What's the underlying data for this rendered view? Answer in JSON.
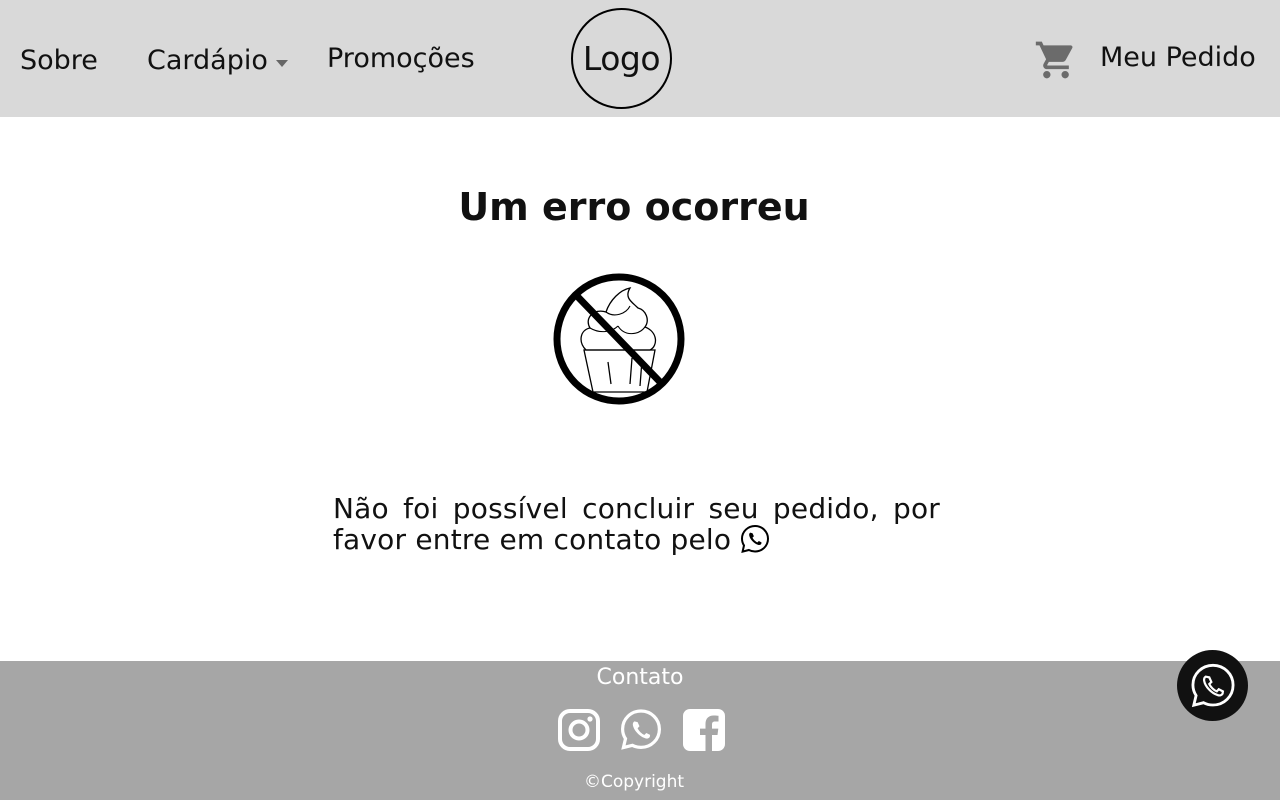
{
  "header": {
    "nav": {
      "sobre": "Sobre",
      "cardapio": "Cardápio",
      "promocoes": "Promoções",
      "pedido": "Meu Pedido"
    },
    "logo": "Logo",
    "icons": {
      "cart": "shopping-cart-icon",
      "dropdown": "caret-down-icon"
    }
  },
  "main": {
    "title": "Um erro ocorreu",
    "illustration": "no-cupcake-icon",
    "message_line1": "Não foi possível concluir seu pedido, por",
    "message_line2": "favor entre em contato pelo",
    "inline_icon": "whatsapp-icon"
  },
  "footer": {
    "title": "Contato",
    "social": [
      "instagram-icon",
      "whatsapp-icon",
      "facebook-icon"
    ],
    "copyright": "©Copyright"
  },
  "floating_button": {
    "icon": "whatsapp-icon"
  },
  "colors": {
    "header_bg": "#d9d9d9",
    "footer_bg": "#a6a6a6",
    "text": "#111111",
    "footer_text": "#ffffff",
    "float_bg": "#111111"
  }
}
